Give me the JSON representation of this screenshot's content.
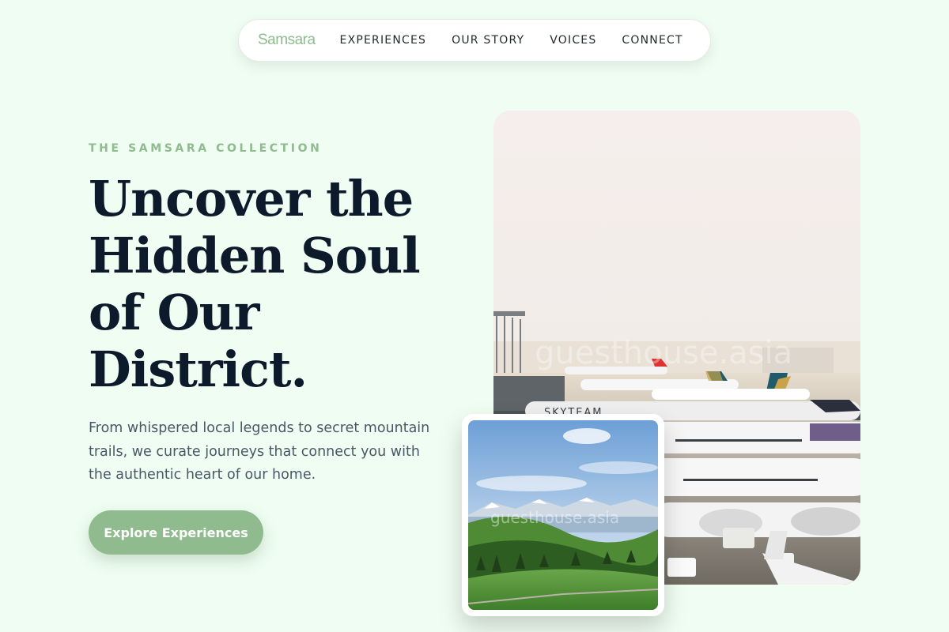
{
  "nav": {
    "brand": "Samsara",
    "links": [
      "EXPERIENCES",
      "OUR STORY",
      "VOICES",
      "CONNECT"
    ]
  },
  "hero": {
    "eyebrow": "THE SAMSARA COLLECTION",
    "headline_lines": [
      "Uncover the",
      "Hidden Soul",
      "of Our",
      "District."
    ],
    "lead": "From whispered local legends to secret mountain trails, we curate journeys that connect you with the authentic heart of our home.",
    "cta_label": "Explore Experiences"
  },
  "images": {
    "main": {
      "watermark": "guesthouse.asia",
      "sign_text": "SKYTEAM"
    },
    "inset": {
      "watermark": "guesthouse.asia"
    }
  },
  "colors": {
    "background": "#effdf2",
    "accent": "#8fbb8f",
    "headline": "#0d1a2b",
    "body_text": "#4a5866"
  }
}
